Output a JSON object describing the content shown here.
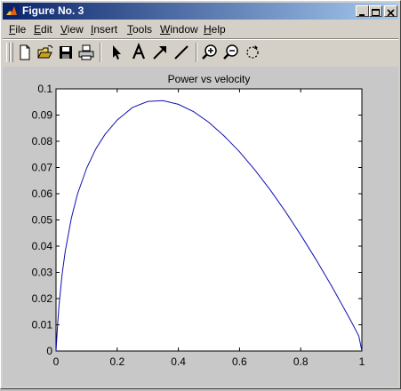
{
  "window": {
    "title": "Figure No. 3",
    "controls": [
      "minimize",
      "maximize",
      "close"
    ]
  },
  "menubar": {
    "items": [
      {
        "label": "File",
        "mnemonic": "F"
      },
      {
        "label": "Edit",
        "mnemonic": "E"
      },
      {
        "label": "View",
        "mnemonic": "V"
      },
      {
        "label": "Insert",
        "mnemonic": "I"
      },
      {
        "label": "Tools",
        "mnemonic": "T"
      },
      {
        "label": "Window",
        "mnemonic": "W"
      },
      {
        "label": "Help",
        "mnemonic": "H"
      }
    ]
  },
  "toolbar": {
    "tools": [
      "new-figure-icon",
      "open-file-icon",
      "save-icon",
      "print-icon",
      "select-arrow-icon",
      "insert-text-icon",
      "insert-arrow-icon",
      "insert-line-icon",
      "zoom-in-icon",
      "zoom-out-icon",
      "rotate-3d-icon"
    ]
  },
  "colors": {
    "line": "#1010b0",
    "titlebar_start": "#0a246a",
    "titlebar_end": "#a6caf0",
    "figure_bg": "#c8c8c8",
    "axes_bg": "#ffffff"
  },
  "chart_data": {
    "type": "line",
    "title": "Power vs velocity",
    "xlabel": "",
    "ylabel": "",
    "xlim": [
      0,
      1
    ],
    "ylim": [
      0,
      0.1
    ],
    "xticks": [
      "0",
      "0.2",
      "0.4",
      "0.6",
      "0.8",
      "1"
    ],
    "yticks": [
      "0",
      "0.01",
      "0.02",
      "0.03",
      "0.04",
      "0.05",
      "0.06",
      "0.07",
      "0.08",
      "0.09",
      "0.1"
    ],
    "grid": false,
    "legend": "none",
    "series": [
      {
        "x": [
          0,
          0.005,
          0.01,
          0.02,
          0.03,
          0.05,
          0.07,
          0.1,
          0.13,
          0.16,
          0.2,
          0.25,
          0.3,
          0.35,
          0.4,
          0.45,
          0.5,
          0.55,
          0.6,
          0.65,
          0.7,
          0.75,
          0.8,
          0.85,
          0.9,
          0.95,
          0.97,
          0.99,
          1.0
        ],
        "values": [
          0,
          0.0098,
          0.0176,
          0.0293,
          0.0379,
          0.0506,
          0.0598,
          0.0697,
          0.0771,
          0.0826,
          0.0881,
          0.0929,
          0.0952,
          0.0955,
          0.0941,
          0.0913,
          0.0872,
          0.082,
          0.076,
          0.0691,
          0.0615,
          0.0532,
          0.0443,
          0.0349,
          0.025,
          0.0145,
          0.0102,
          0.0057,
          0
        ]
      }
    ]
  }
}
